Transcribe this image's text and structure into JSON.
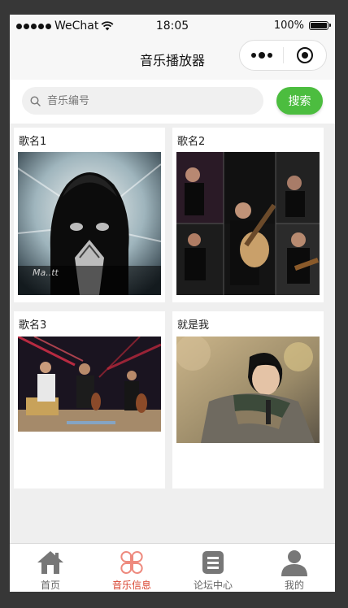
{
  "status_bar": {
    "carrier": "WeChat",
    "time": "18:05",
    "battery": "100%"
  },
  "nav": {
    "title": "音乐播放器"
  },
  "search": {
    "placeholder": "音乐编号",
    "value": "",
    "button_label": "搜索"
  },
  "songs": [
    {
      "title": "歌名1"
    },
    {
      "title": "歌名2"
    },
    {
      "title": "歌名3"
    },
    {
      "title": "就是我"
    }
  ],
  "tabbar": {
    "items": [
      {
        "label": "首页",
        "icon": "home-icon",
        "active": false
      },
      {
        "label": "音乐信息",
        "icon": "clover-icon",
        "active": true
      },
      {
        "label": "论坛中心",
        "icon": "list-icon",
        "active": false
      },
      {
        "label": "我的",
        "icon": "user-icon",
        "active": false
      }
    ]
  },
  "colors": {
    "accent_green": "#4cbd3f",
    "active_tab": "#d8432f",
    "background": "#efefef"
  }
}
